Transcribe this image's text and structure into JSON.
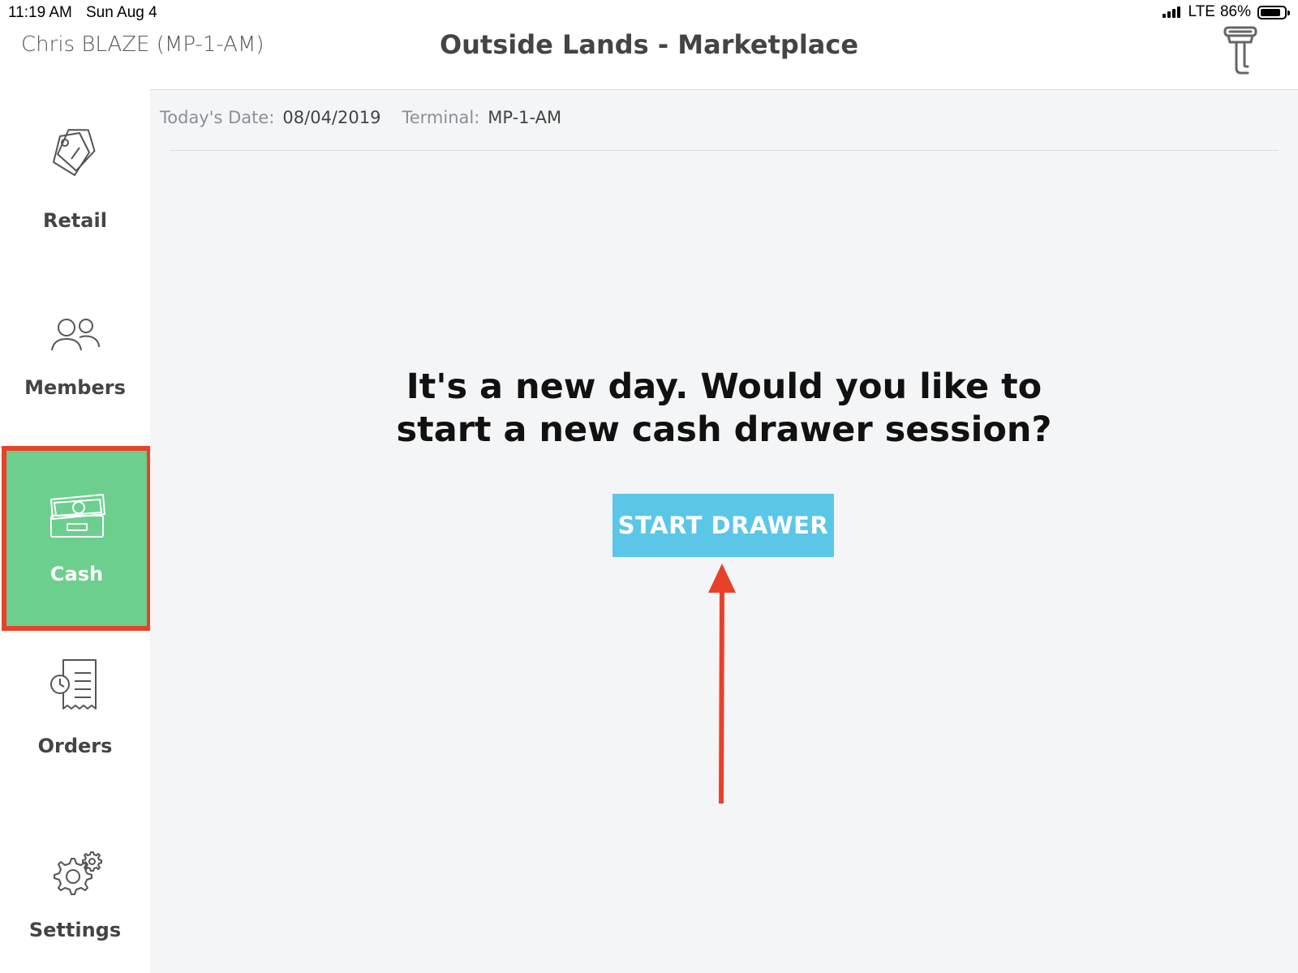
{
  "status_bar": {
    "time": "11:19 AM",
    "date": "Sun Aug 4",
    "network": "LTE",
    "battery": "86%",
    "battery_level": 0.86
  },
  "header": {
    "user": "Chris BLAZE (MP-1-AM)",
    "title": "Outside Lands - Marketplace",
    "right_icon": "barcode-scanner-icon"
  },
  "sidebar": {
    "items": [
      {
        "label": "Retail",
        "icon": "price-tags-icon",
        "active": false
      },
      {
        "label": "Members",
        "icon": "people-icon",
        "active": false
      },
      {
        "label": "Cash",
        "icon": "cash-drawer-icon",
        "active": true
      },
      {
        "label": "Orders",
        "icon": "receipt-clock-icon",
        "active": false
      },
      {
        "label": "Settings",
        "icon": "gears-icon",
        "active": false
      }
    ]
  },
  "info": {
    "date_label": "Today's Date:",
    "date_value": "08/04/2019",
    "terminal_label": "Terminal:",
    "terminal_value": "MP-1-AM"
  },
  "prompt": {
    "line1": "It's a new day. Would you like to",
    "line2": "start a new cash drawer session?"
  },
  "start_button": {
    "label": "START DRAWER"
  },
  "colors": {
    "active_nav_bg": "#6ccf8e",
    "highlight_border": "#e8412a",
    "button_bg": "#5bc6e8",
    "main_bg": "#f4f5f7"
  }
}
